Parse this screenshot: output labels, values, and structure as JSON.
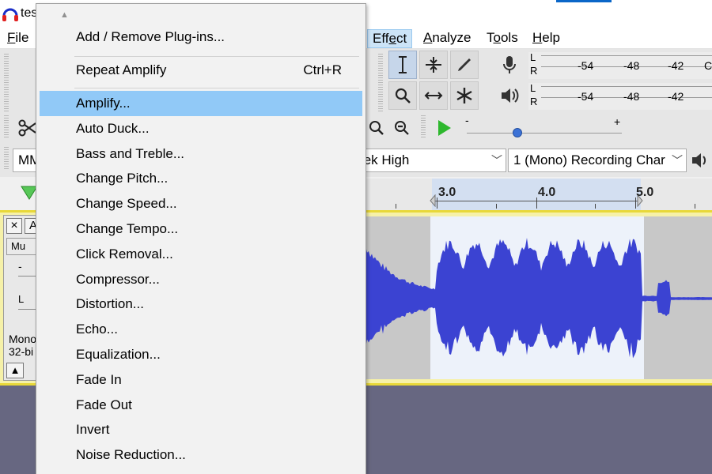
{
  "window": {
    "title_text": "tes"
  },
  "menubar": {
    "items": [
      {
        "label_prefix": "",
        "label_ul": "F",
        "label_rest": "ile"
      },
      {
        "label_prefix": "Eff",
        "label_ul": "e",
        "label_rest": "ct"
      },
      {
        "label_prefix": "",
        "label_ul": "A",
        "label_rest": "nalyze"
      },
      {
        "label_prefix": "T",
        "label_ul": "o",
        "label_rest": "ols"
      },
      {
        "label_prefix": "",
        "label_ul": "H",
        "label_rest": "elp"
      }
    ]
  },
  "meters": {
    "record": {
      "l": "L",
      "r": "R",
      "ticks": [
        "-54",
        "-48",
        "-42",
        "C"
      ]
    },
    "play": {
      "l": "L",
      "r": "R",
      "ticks": [
        "-54",
        "-48",
        "-42"
      ]
    }
  },
  "speed_slider": {
    "minus": "-",
    "plus": "+"
  },
  "device_bar": {
    "host_fragment": "MM",
    "input_device": "tek High",
    "channels": "1 (Mono) Recording Char"
  },
  "ruler": {
    "labels": [
      "3.0",
      "4.0",
      "5.0"
    ]
  },
  "track": {
    "close": "×",
    "name_fragment": "A",
    "mute_fragment": "Mu",
    "gain_minus": "-",
    "pan_l": "L",
    "info_line1": "Mono",
    "info_line2": "32-bi",
    "collapse": "▲"
  },
  "effect_menu": {
    "header_items": [
      {
        "label": "Add / Remove Plug-ins..."
      },
      {
        "label": "Repeat Amplify",
        "shortcut": "Ctrl+R"
      }
    ],
    "items": [
      {
        "label": "Amplify...",
        "highlighted": true
      },
      {
        "label": "Auto Duck..."
      },
      {
        "label": "Bass and Treble..."
      },
      {
        "label": "Change Pitch..."
      },
      {
        "label": "Change Speed..."
      },
      {
        "label": "Change Tempo..."
      },
      {
        "label": "Click Removal..."
      },
      {
        "label": "Compressor..."
      },
      {
        "label": "Distortion..."
      },
      {
        "label": "Echo..."
      },
      {
        "label": "Equalization..."
      },
      {
        "label": "Fade In"
      },
      {
        "label": "Fade Out"
      },
      {
        "label": "Invert"
      },
      {
        "label": "Noise Reduction..."
      }
    ]
  },
  "colors": {
    "waveform": "#3b43d2",
    "selection": "#edf2fa",
    "menu_highlight": "#91c9f7",
    "track_border": "#e8d839",
    "play_green": "#2eb82e"
  }
}
